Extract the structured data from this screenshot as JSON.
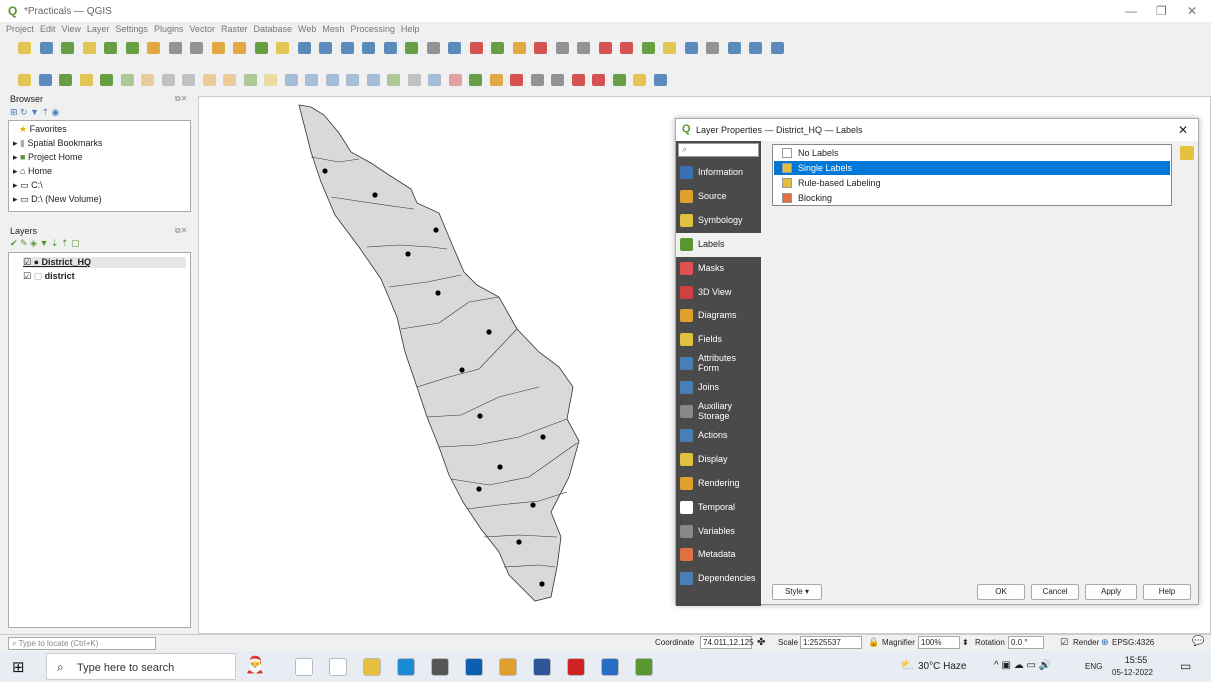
{
  "window": {
    "title": "*Practicals — QGIS",
    "min": "—",
    "max": "❐",
    "close": "✕"
  },
  "menu": [
    "Project",
    "Edit",
    "View",
    "Layer",
    "Settings",
    "Plugins",
    "Vector",
    "Raster",
    "Database",
    "Web",
    "Mesh",
    "Processing",
    "Help"
  ],
  "browser": {
    "title": "Browser",
    "items": [
      "Favorites",
      "Spatial Bookmarks",
      "Project Home",
      "Home",
      "C:\\",
      "D:\\ (New Volume)"
    ]
  },
  "layers": {
    "title": "Layers",
    "items": [
      "District_HQ",
      "district"
    ]
  },
  "dialog": {
    "title": "Layer Properties — District_HQ — Labels",
    "close": "✕",
    "search_placeholder": "",
    "tabs": [
      "Information",
      "Source",
      "Symbology",
      "Labels",
      "Masks",
      "3D View",
      "Diagrams",
      "Fields",
      "Attributes Form",
      "Joins",
      "Auxiliary Storage",
      "Actions",
      "Display",
      "Rendering",
      "Temporal",
      "Variables",
      "Metadata",
      "Dependencies"
    ],
    "selected_tab": "Labels",
    "label_options": [
      "No Labels",
      "Single Labels",
      "Rule-based Labeling",
      "Blocking"
    ],
    "selected_option": "Single Labels",
    "style": "Style",
    "ok": "OK",
    "cancel": "Cancel",
    "apply": "Apply",
    "help": "Help"
  },
  "status": {
    "locate_placeholder": "Type to locate (Ctrl+K)",
    "coordinate_label": "Coordinate",
    "coordinate": "74.011,12.125",
    "scale_label": "Scale",
    "scale": "1:2525537",
    "magnifier_label": "Magnifier",
    "magnifier": "100%",
    "rotation_label": "Rotation",
    "rotation": "0.0 °",
    "render": "Render",
    "crs": "EPSG:4326"
  },
  "taskbar": {
    "search": "Type here to search",
    "weather": "30°C Haze",
    "lang": "ENG",
    "time": "15:55",
    "date": "05-12-2022"
  }
}
